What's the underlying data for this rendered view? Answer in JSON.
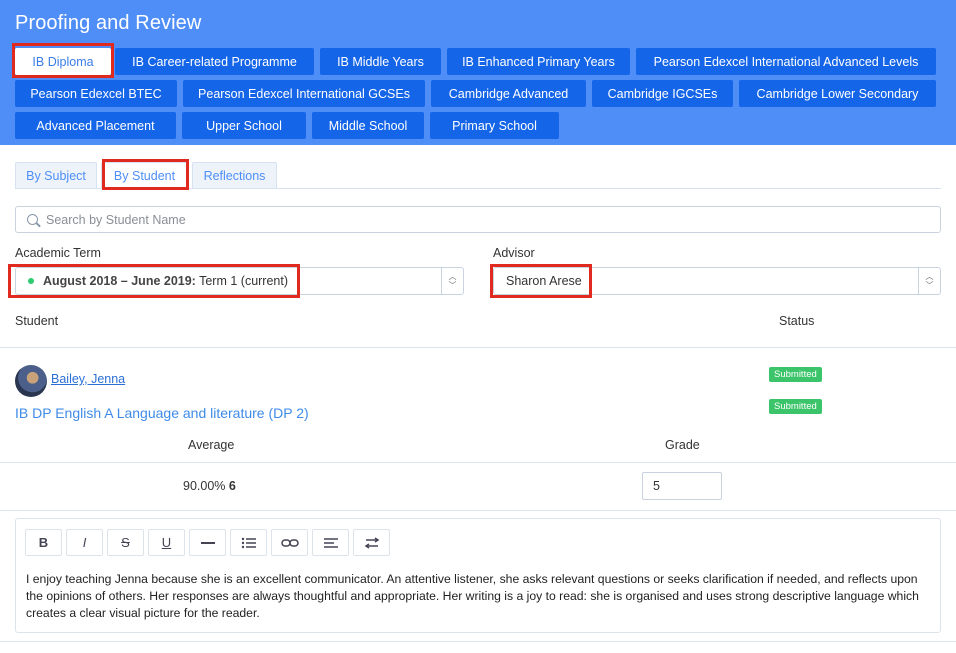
{
  "header": {
    "title": "Proofing and Review",
    "programmes": [
      "IB Diploma",
      "IB Career-related Programme",
      "IB Middle Years",
      "IB Enhanced Primary Years",
      "Pearson Edexcel International Advanced Levels",
      "Pearson Edexcel BTEC",
      "Pearson Edexcel International GCSEs",
      "Cambridge Advanced",
      "Cambridge IGCSEs",
      "Cambridge Lower Secondary",
      "Advanced Placement",
      "Upper School",
      "Middle School",
      "Primary School"
    ],
    "active_programme": "IB Diploma"
  },
  "tabs": [
    "By Subject",
    "By Student",
    "Reflections"
  ],
  "active_tab": "By Student",
  "search": {
    "placeholder": "Search by Student Name",
    "value": ""
  },
  "filters": {
    "term_label": "Academic Term",
    "term_value_bold": "August 2018 – June 2019:",
    "term_value_rest": " Term 1 (current)",
    "advisor_label": "Advisor",
    "advisor_value": "Sharon Arese"
  },
  "table": {
    "col_student": "Student",
    "col_status": "Status"
  },
  "student": {
    "name": "Bailey, Jenna",
    "status_badges": [
      "Submitted",
      "Submitted"
    ],
    "subject": "IB DP English A Language and literature (DP 2)",
    "col_average": "Average",
    "col_grade": "Grade",
    "average": "90.00%",
    "average_grade": "6",
    "grade_input": "5"
  },
  "editor": {
    "toolbar": [
      "B",
      "I",
      "S",
      "U",
      "—",
      "list",
      "link",
      "align",
      "swap"
    ],
    "text": "I enjoy teaching Jenna because she is an excellent communicator. An attentive listener, she asks relevant questions or seeks clarification if needed, and reflects upon the opinions of others. Her responses are always thoughtful and appropriate. Her writing is a joy to read: she is organised and uses strong descriptive language which creates a clear visual picture for the reader."
  },
  "colors": {
    "header_bg": "#4f8ef7",
    "button_bg": "#1565e8",
    "highlight": "#e0291f",
    "badge": "#3cc46a",
    "link": "#2b6fd6"
  }
}
